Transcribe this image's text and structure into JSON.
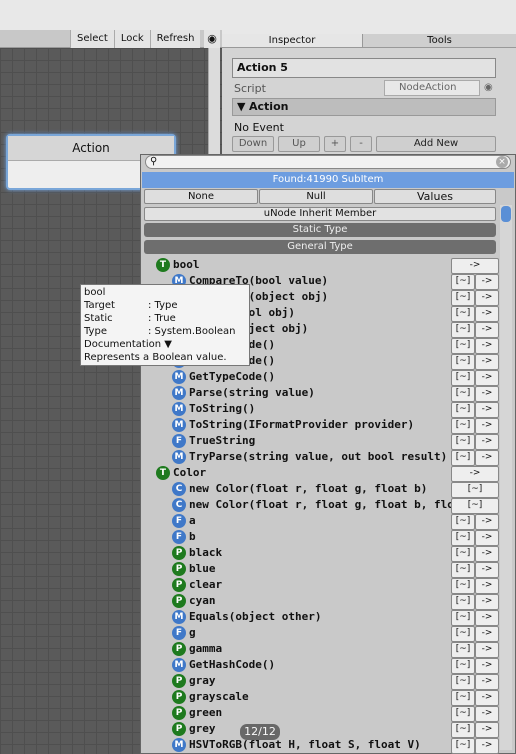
{
  "toolbar": {
    "select": "Select",
    "lock": "Lock",
    "refresh": "Refresh"
  },
  "tabs": {
    "inspector": "Inspector",
    "tools": "Tools"
  },
  "node": {
    "title": "Action"
  },
  "inspector": {
    "title": "Action 5",
    "script_label": "Script",
    "script_value": "NodeAction",
    "fold_title": "Action",
    "no_event": "No Event",
    "buttons": {
      "down": "Down",
      "up": "Up",
      "plus": "+",
      "minus": "-",
      "add_new": "Add New"
    }
  },
  "popup": {
    "search_value": "",
    "found": "Found:41990 SubItem",
    "filters": {
      "none": "None",
      "null": "Null",
      "values": "Values"
    },
    "inherit": "uNode Inherit Member",
    "static_type": "Static Type",
    "general_type": "General Type",
    "rows": [
      {
        "kind": "T",
        "label": "bool",
        "level": 0,
        "btn1": "",
        "btn2": "->"
      },
      {
        "kind": "M",
        "label": "CompareTo(bool value)",
        "level": 1,
        "btn1": "[~]",
        "btn2": "->"
      },
      {
        "kind": "M",
        "label": "CompareTo(object obj)",
        "level": 1,
        "btn1": "[~]",
        "btn2": "->"
      },
      {
        "kind": "M",
        "label": "Equals(bool obj)",
        "level": 1,
        "btn1": "[~]",
        "btn2": "->"
      },
      {
        "kind": "M",
        "label": "Equals(object obj)",
        "level": 1,
        "btn1": "[~]",
        "btn2": "->"
      },
      {
        "kind": "M",
        "label": "GetHashCode()",
        "level": 1,
        "btn1": "[~]",
        "btn2": "->"
      },
      {
        "kind": "M",
        "label": "GetTypeCode()",
        "level": 1,
        "btn1": "[~]",
        "btn2": "->"
      },
      {
        "kind": "M",
        "label": "GetTypeCode()",
        "level": 1,
        "btn1": "[~]",
        "btn2": "->"
      },
      {
        "kind": "M",
        "label": "Parse(string value)",
        "level": 1,
        "btn1": "[~]",
        "btn2": "->"
      },
      {
        "kind": "M",
        "label": "ToString()",
        "level": 1,
        "btn1": "[~]",
        "btn2": "->"
      },
      {
        "kind": "M",
        "label": "ToString(IFormatProvider provider)",
        "level": 1,
        "btn1": "[~]",
        "btn2": "->"
      },
      {
        "kind": "F",
        "label": "TrueString",
        "level": 1,
        "btn1": "[~]",
        "btn2": "->"
      },
      {
        "kind": "M",
        "label": "TryParse(string value, out bool result)",
        "level": 1,
        "btn1": "[~]",
        "btn2": "->"
      },
      {
        "kind": "T",
        "label": "Color",
        "level": 0,
        "btn1": "",
        "btn2": "->"
      },
      {
        "kind": "C",
        "label": "new Color(float r, float g, float b)",
        "level": 1,
        "btn1": "[~]",
        "btn2": ""
      },
      {
        "kind": "C",
        "label": "new Color(float r, float g, float b, float a)",
        "level": 1,
        "btn1": "[~]",
        "btn2": ""
      },
      {
        "kind": "F",
        "label": "a",
        "level": 1,
        "btn1": "[~]",
        "btn2": "->"
      },
      {
        "kind": "F",
        "label": "b",
        "level": 1,
        "btn1": "[~]",
        "btn2": "->"
      },
      {
        "kind": "P",
        "label": "black",
        "level": 1,
        "btn1": "[~]",
        "btn2": "->"
      },
      {
        "kind": "P",
        "label": "blue",
        "level": 1,
        "btn1": "[~]",
        "btn2": "->"
      },
      {
        "kind": "P",
        "label": "clear",
        "level": 1,
        "btn1": "[~]",
        "btn2": "->"
      },
      {
        "kind": "P",
        "label": "cyan",
        "level": 1,
        "btn1": "[~]",
        "btn2": "->"
      },
      {
        "kind": "M",
        "label": "Equals(object other)",
        "level": 1,
        "btn1": "[~]",
        "btn2": "->"
      },
      {
        "kind": "F",
        "label": "g",
        "level": 1,
        "btn1": "[~]",
        "btn2": "->"
      },
      {
        "kind": "P",
        "label": "gamma",
        "level": 1,
        "btn1": "[~]",
        "btn2": "->"
      },
      {
        "kind": "M",
        "label": "GetHashCode()",
        "level": 1,
        "btn1": "[~]",
        "btn2": "->"
      },
      {
        "kind": "P",
        "label": "gray",
        "level": 1,
        "btn1": "[~]",
        "btn2": "->"
      },
      {
        "kind": "P",
        "label": "grayscale",
        "level": 1,
        "btn1": "[~]",
        "btn2": "->"
      },
      {
        "kind": "P",
        "label": "green",
        "level": 1,
        "btn1": "[~]",
        "btn2": "->"
      },
      {
        "kind": "P",
        "label": "grey",
        "level": 1,
        "btn1": "[~]",
        "btn2": "->"
      },
      {
        "kind": "M",
        "label": "HSVToRGB(float H, float S, float V)",
        "level": 1,
        "btn1": "[~]",
        "btn2": "->"
      }
    ]
  },
  "tooltip": {
    "title": "bool",
    "target_k": "Target",
    "target_v": ": Type",
    "static_k": "Static",
    "static_v": ": True",
    "type_k": "Type",
    "type_v": ": System.Boolean",
    "doc": "Documentation ▼",
    "desc": "Represents a Boolean value."
  },
  "page_indicator": "12/12"
}
